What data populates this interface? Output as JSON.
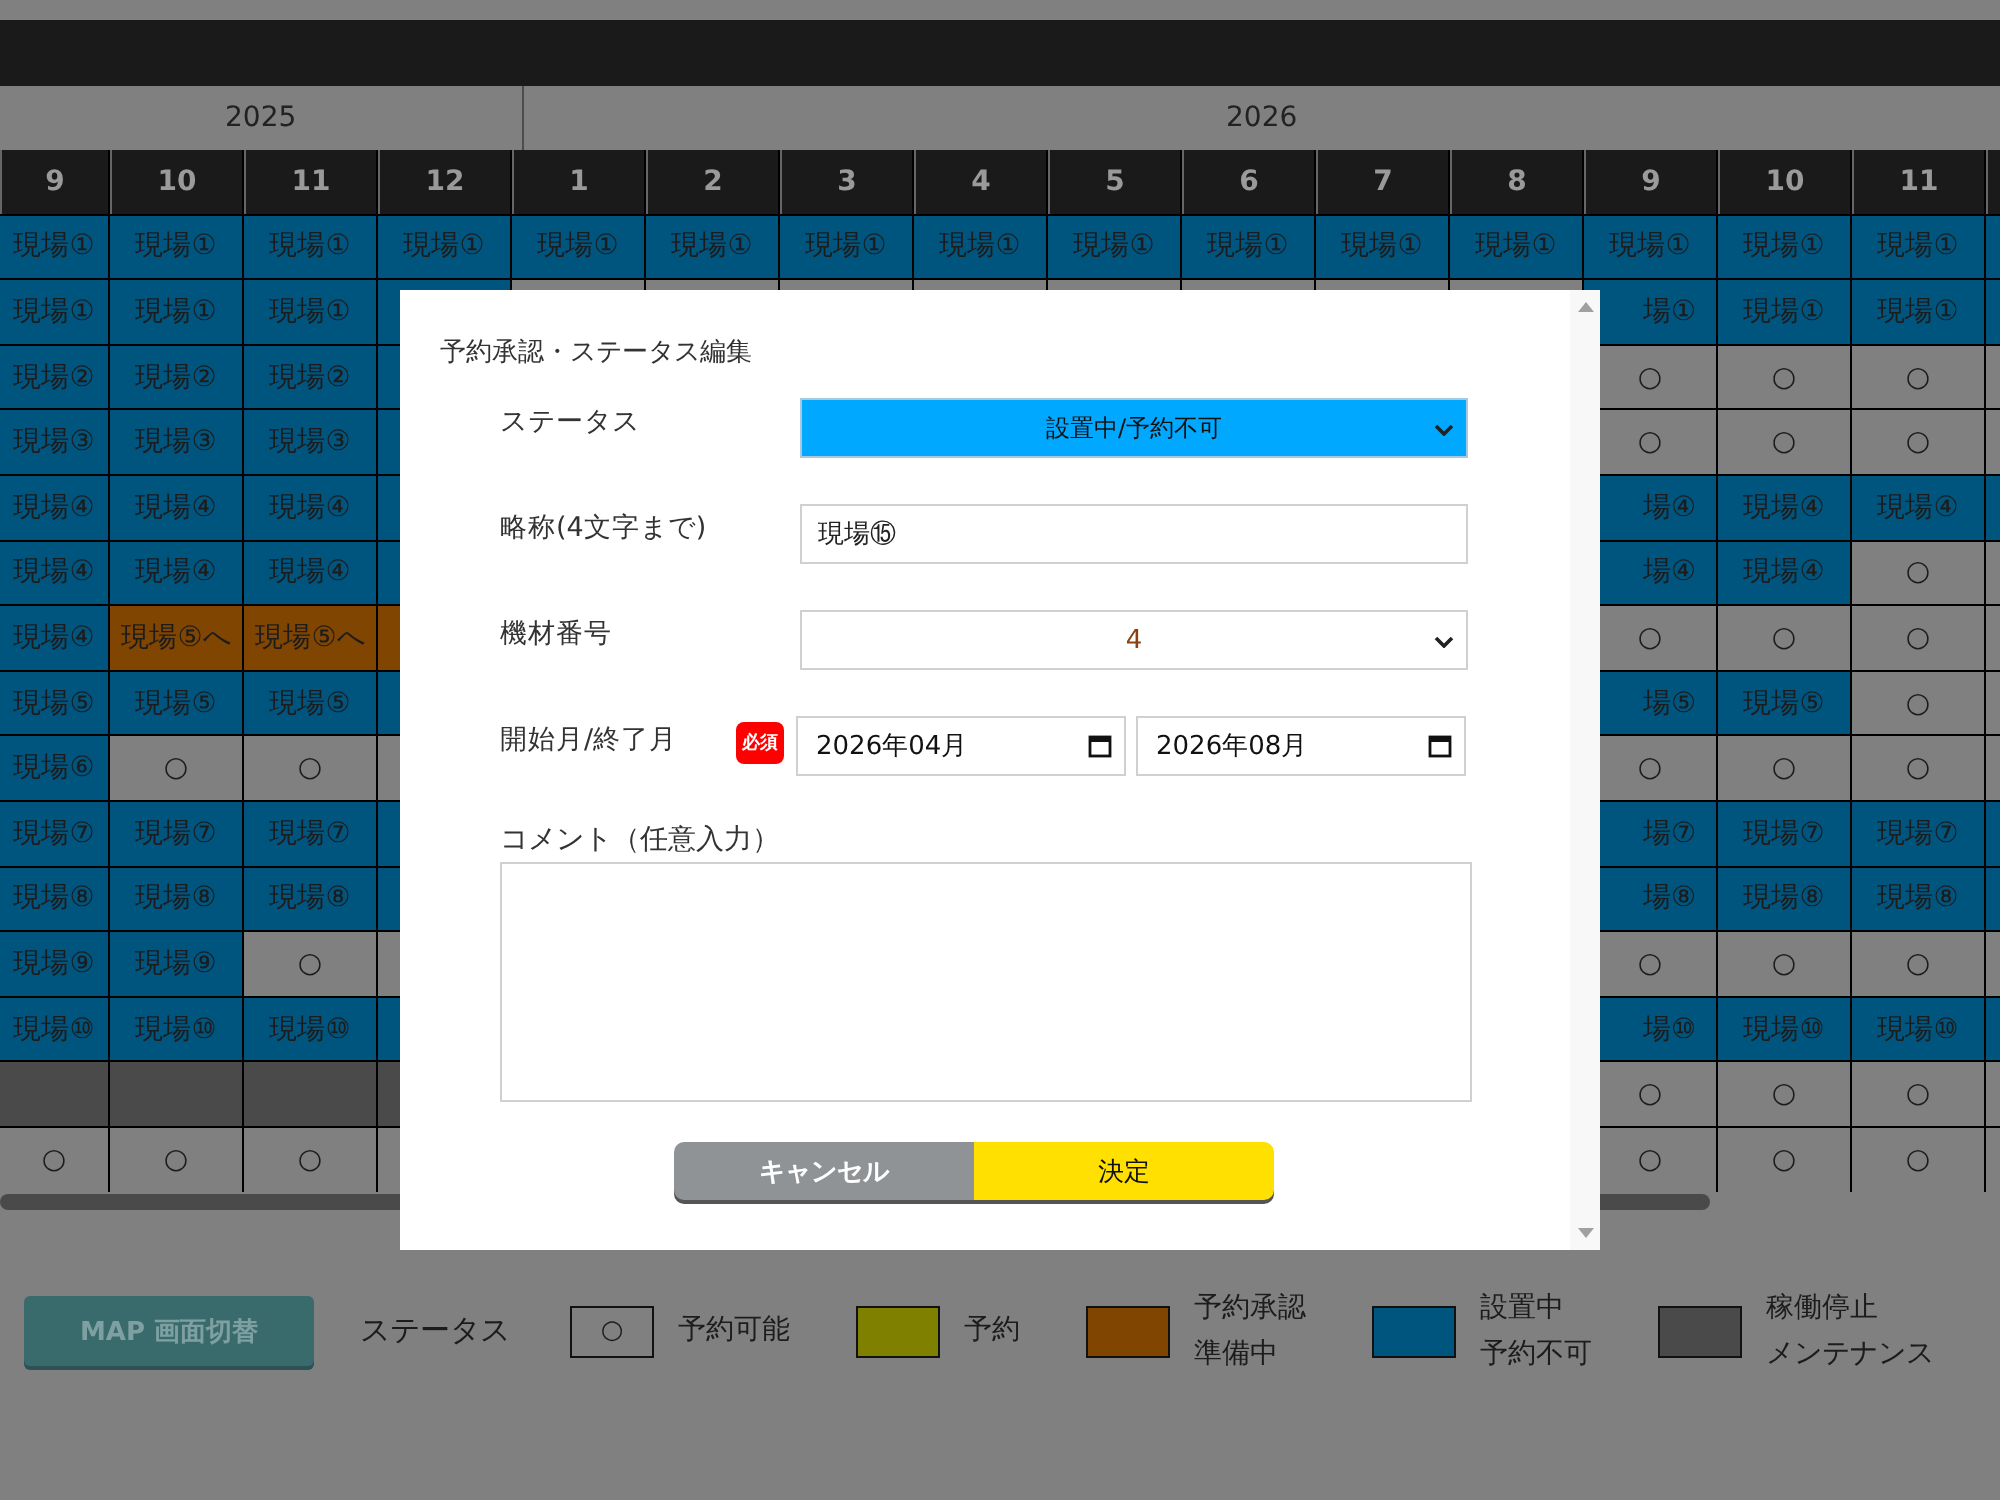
{
  "schedule": {
    "years": [
      {
        "label": "2025",
        "months": [
          "9",
          "10",
          "11",
          "12"
        ]
      },
      {
        "label": "2026",
        "months": [
          "1",
          "2",
          "3",
          "4",
          "5",
          "6",
          "7",
          "8",
          "9",
          "10",
          "11"
        ]
      }
    ],
    "rows": [
      [
        {
          "kind": "site",
          "text": "現場①"
        },
        {
          "kind": "site",
          "text": "現場①"
        },
        {
          "kind": "site",
          "text": "現場①"
        },
        {
          "kind": "site",
          "text": "現場①"
        },
        {
          "kind": "site",
          "text": "現場①"
        },
        {
          "kind": "site",
          "text": "現場①"
        },
        {
          "kind": "site",
          "text": "現場①"
        },
        {
          "kind": "site",
          "text": "現場①"
        },
        {
          "kind": "site",
          "text": "現場①"
        },
        {
          "kind": "site",
          "text": "現場①"
        },
        {
          "kind": "site",
          "text": "現場①"
        },
        {
          "kind": "site",
          "text": "現場①"
        },
        {
          "kind": "site",
          "text": "現場①"
        },
        {
          "kind": "site",
          "text": "現場①"
        },
        {
          "kind": "site",
          "text": "現場①"
        },
        {
          "kind": "site"
        }
      ],
      [
        {
          "kind": "site",
          "text": "現場①"
        },
        {
          "kind": "site",
          "text": "現場①"
        },
        {
          "kind": "site",
          "text": "現場①"
        },
        {
          "kind": "site"
        },
        null,
        null,
        null,
        null,
        null,
        null,
        null,
        null,
        {
          "kind": "site",
          "text": "場①"
        },
        {
          "kind": "site",
          "text": "現場①"
        },
        {
          "kind": "site",
          "text": "現場①"
        },
        {
          "kind": "site"
        }
      ],
      [
        {
          "kind": "site",
          "text": "現場②"
        },
        {
          "kind": "site",
          "text": "現場②"
        },
        {
          "kind": "site",
          "text": "現場②"
        },
        {
          "kind": "site"
        },
        null,
        null,
        null,
        null,
        null,
        null,
        null,
        null,
        {
          "kind": "free",
          "text": "○"
        },
        {
          "kind": "free",
          "text": "○"
        },
        {
          "kind": "free",
          "text": "○"
        },
        {
          "kind": "free"
        }
      ],
      [
        {
          "kind": "site",
          "text": "現場③"
        },
        {
          "kind": "site",
          "text": "現場③"
        },
        {
          "kind": "site",
          "text": "現場③"
        },
        {
          "kind": "site"
        },
        null,
        null,
        null,
        null,
        null,
        null,
        null,
        null,
        {
          "kind": "free",
          "text": "○"
        },
        {
          "kind": "free",
          "text": "○"
        },
        {
          "kind": "free",
          "text": "○"
        },
        {
          "kind": "free"
        }
      ],
      [
        {
          "kind": "site",
          "text": "現場④"
        },
        {
          "kind": "site",
          "text": "現場④"
        },
        {
          "kind": "site",
          "text": "現場④"
        },
        {
          "kind": "site"
        },
        null,
        null,
        null,
        null,
        null,
        null,
        null,
        null,
        {
          "kind": "site",
          "text": "場④"
        },
        {
          "kind": "site",
          "text": "現場④"
        },
        {
          "kind": "site",
          "text": "現場④"
        },
        {
          "kind": "site"
        }
      ],
      [
        {
          "kind": "site",
          "text": "現場④"
        },
        {
          "kind": "site",
          "text": "現場④"
        },
        {
          "kind": "site",
          "text": "現場④"
        },
        {
          "kind": "site"
        },
        null,
        null,
        null,
        null,
        null,
        null,
        null,
        null,
        {
          "kind": "site",
          "text": "場④"
        },
        {
          "kind": "site",
          "text": "現場④"
        },
        {
          "kind": "free",
          "text": "○"
        },
        {
          "kind": "free"
        }
      ],
      [
        {
          "kind": "site",
          "text": "現場④"
        },
        {
          "kind": "prep",
          "text": "現場⑤へ"
        },
        {
          "kind": "prep",
          "text": "現場⑤へ"
        },
        {
          "kind": "prep"
        },
        null,
        null,
        null,
        null,
        null,
        null,
        null,
        null,
        {
          "kind": "free",
          "text": "○"
        },
        {
          "kind": "free",
          "text": "○"
        },
        {
          "kind": "free",
          "text": "○"
        },
        {
          "kind": "free"
        }
      ],
      [
        {
          "kind": "site",
          "text": "現場⑤"
        },
        {
          "kind": "site",
          "text": "現場⑤"
        },
        {
          "kind": "site",
          "text": "現場⑤"
        },
        {
          "kind": "site"
        },
        null,
        null,
        null,
        null,
        null,
        null,
        null,
        null,
        {
          "kind": "site",
          "text": "場⑤"
        },
        {
          "kind": "site",
          "text": "現場⑤"
        },
        {
          "kind": "free",
          "text": "○"
        },
        {
          "kind": "free"
        }
      ],
      [
        {
          "kind": "site",
          "text": "現場⑥"
        },
        {
          "kind": "free",
          "text": "○"
        },
        {
          "kind": "free",
          "text": "○"
        },
        {
          "kind": "free"
        },
        null,
        null,
        null,
        null,
        null,
        null,
        null,
        null,
        {
          "kind": "free",
          "text": "○"
        },
        {
          "kind": "free",
          "text": "○"
        },
        {
          "kind": "free",
          "text": "○"
        },
        {
          "kind": "free"
        }
      ],
      [
        {
          "kind": "site",
          "text": "現場⑦"
        },
        {
          "kind": "site",
          "text": "現場⑦"
        },
        {
          "kind": "site",
          "text": "現場⑦"
        },
        {
          "kind": "site"
        },
        null,
        null,
        null,
        null,
        null,
        null,
        null,
        null,
        {
          "kind": "site",
          "text": "場⑦"
        },
        {
          "kind": "site",
          "text": "現場⑦"
        },
        {
          "kind": "site",
          "text": "現場⑦"
        },
        {
          "kind": "site"
        }
      ],
      [
        {
          "kind": "site",
          "text": "現場⑧"
        },
        {
          "kind": "site",
          "text": "現場⑧"
        },
        {
          "kind": "site",
          "text": "現場⑧"
        },
        {
          "kind": "site"
        },
        null,
        null,
        null,
        null,
        null,
        null,
        null,
        null,
        {
          "kind": "site",
          "text": "場⑧"
        },
        {
          "kind": "site",
          "text": "現場⑧"
        },
        {
          "kind": "site",
          "text": "現場⑧"
        },
        {
          "kind": "site"
        }
      ],
      [
        {
          "kind": "site",
          "text": "現場⑨"
        },
        {
          "kind": "site",
          "text": "現場⑨"
        },
        {
          "kind": "free",
          "text": "○"
        },
        {
          "kind": "free"
        },
        null,
        null,
        null,
        null,
        null,
        null,
        null,
        null,
        {
          "kind": "free",
          "text": "○"
        },
        {
          "kind": "free",
          "text": "○"
        },
        {
          "kind": "free",
          "text": "○"
        },
        {
          "kind": "free"
        }
      ],
      [
        {
          "kind": "site",
          "text": "現場⑩"
        },
        {
          "kind": "site",
          "text": "現場⑩"
        },
        {
          "kind": "site",
          "text": "現場⑩"
        },
        {
          "kind": "site"
        },
        null,
        null,
        null,
        null,
        null,
        null,
        null,
        null,
        {
          "kind": "site",
          "text": "場⑩"
        },
        {
          "kind": "site",
          "text": "現場⑩"
        },
        {
          "kind": "site",
          "text": "現場⑩"
        },
        {
          "kind": "site"
        }
      ],
      [
        {
          "kind": "stop"
        },
        {
          "kind": "stop"
        },
        {
          "kind": "stop"
        },
        {
          "kind": "stop"
        },
        null,
        null,
        null,
        null,
        null,
        null,
        null,
        null,
        {
          "kind": "free",
          "text": "○"
        },
        {
          "kind": "free",
          "text": "○"
        },
        {
          "kind": "free",
          "text": "○"
        },
        {
          "kind": "free"
        }
      ],
      [
        {
          "kind": "free",
          "text": "○"
        },
        {
          "kind": "free",
          "text": "○"
        },
        {
          "kind": "free",
          "text": "○"
        },
        {
          "kind": "free"
        },
        null,
        null,
        null,
        null,
        null,
        null,
        null,
        null,
        {
          "kind": "free",
          "text": "○"
        },
        {
          "kind": "free",
          "text": "○"
        },
        {
          "kind": "free",
          "text": "○"
        },
        {
          "kind": "free"
        }
      ]
    ]
  },
  "legend": {
    "map_button": "MAP 画面切替",
    "title": "ステータス",
    "items": [
      {
        "kind": "symbol",
        "symbol": "○",
        "lines": [
          "予約可能"
        ]
      },
      {
        "kind": "color",
        "color": "#808000",
        "lines": [
          "予約"
        ]
      },
      {
        "kind": "color",
        "color": "#804500",
        "lines": [
          "予約承認",
          "準備中"
        ]
      },
      {
        "kind": "color",
        "color": "#00557f",
        "lines": [
          "設置中",
          "予約不可"
        ]
      },
      {
        "kind": "color",
        "color": "#4a4a4a",
        "lines": [
          "稼働停止",
          "メンテナンス"
        ]
      }
    ]
  },
  "dialog": {
    "title": "予約承認・ステータス編集",
    "status": {
      "label": "ステータス",
      "value": "設置中/予約不可"
    },
    "short_name": {
      "label": "略称(4文字まで)",
      "value": "現場⑮"
    },
    "equipment": {
      "label": "機材番号",
      "value": "4"
    },
    "period": {
      "label": "開始月/終了月",
      "required_badge": "必須",
      "start": "2026年04月",
      "end": "2026年08月"
    },
    "comment": {
      "label": "コメント（任意入力）"
    },
    "buttons": {
      "cancel": "キャンセル",
      "ok": "決定"
    }
  }
}
